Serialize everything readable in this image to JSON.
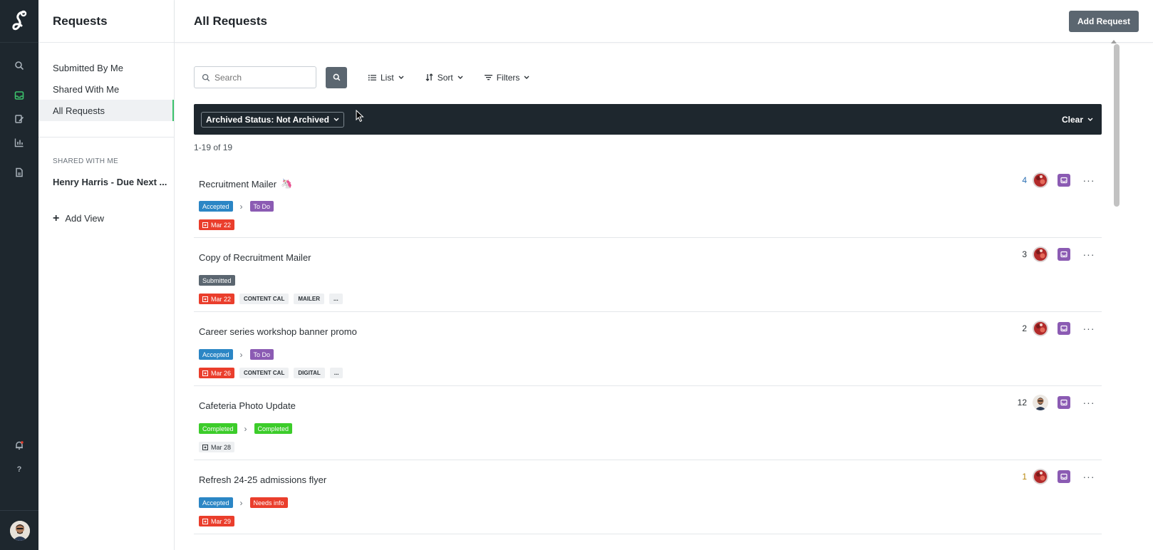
{
  "colors": {
    "rail_bg": "#1e272e",
    "active_accent": "#3cc36c",
    "primary_button": "#5b6670",
    "accepted": "#2b86c5",
    "todo": "#8b5bb3",
    "submitted": "#5b6670",
    "completed": "#3ccc2a",
    "needs_info": "#ea3e2c",
    "overdue": "#ea3e2c"
  },
  "rail": {
    "icons": [
      "logo-icon",
      "search-icon",
      "inbox-icon",
      "edit-icon",
      "chart-icon",
      "document-icon",
      "bell-icon",
      "help-icon"
    ]
  },
  "sidebar": {
    "title": "Requests",
    "items": [
      {
        "label": "Submitted By Me",
        "active": false
      },
      {
        "label": "Shared With Me",
        "active": false
      },
      {
        "label": "All Requests",
        "active": true
      }
    ],
    "section_label": "SHARED WITH ME",
    "shared_view": "Henry Harris - Due Next ...",
    "add_view": "Add View"
  },
  "header": {
    "title": "All Requests",
    "add_button": "Add Request"
  },
  "toolbar": {
    "search_placeholder": "Search",
    "list_label": "List",
    "sort_label": "Sort",
    "filters_label": "Filters"
  },
  "filter": {
    "chip": "Archived Status: Not Archived",
    "clear": "Clear"
  },
  "count_text": "1-19 of 19",
  "requests": [
    {
      "title": "Recruitment Mailer",
      "emoji": "🦄",
      "status_from": "Accepted",
      "status_to": "To Do",
      "due": "Mar 22",
      "due_overdue": true,
      "tags": [],
      "count": "4",
      "count_color": "#2b6fb3"
    },
    {
      "title": "Copy of Recruitment Mailer",
      "status_from": "Submitted",
      "due": "Mar 22",
      "due_overdue": true,
      "tags": [
        "CONTENT CAL",
        "MAILER",
        "..."
      ],
      "count": "3",
      "count_color": "#2b3136"
    },
    {
      "title": "Career series workshop banner promo",
      "status_from": "Accepted",
      "status_to": "To Do",
      "due": "Mar 26",
      "due_overdue": true,
      "tags": [
        "CONTENT CAL",
        "DIGITAL",
        "..."
      ],
      "count": "2",
      "count_color": "#2b3136"
    },
    {
      "title": "Cafeteria Photo Update",
      "status_from": "Completed",
      "status_to": "Completed",
      "due": "Mar 28",
      "due_overdue": false,
      "tags": [],
      "count": "12",
      "count_color": "#2b3136"
    },
    {
      "title": "Refresh 24-25 admissions flyer",
      "status_from": "Accepted",
      "status_to": "Needs info",
      "due": "Mar 29",
      "due_overdue": true,
      "tags": [],
      "count": "1",
      "count_color": "#b8860b"
    }
  ]
}
